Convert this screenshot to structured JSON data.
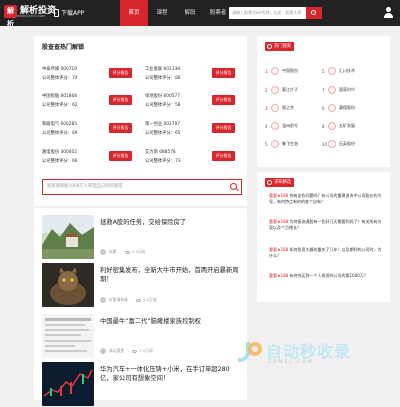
{
  "header": {
    "logo_mark": "解析",
    "logo_text": "解析投资",
    "logo_sub": "www.jiexitz.com",
    "app_label": "下载APP",
    "nav": [
      "首页",
      "课程",
      "解股",
      "股票者",
      "求知"
    ],
    "search_placeholder": "请输入股票代码/名称，比如：股票大师"
  },
  "main": {
    "title": "股查查热门解锁",
    "stocks": [
      {
        "name": "中泰传媒 000719",
        "score": "公司整体评分：74",
        "button": "评分报告"
      },
      {
        "name": "工业富联 601138",
        "score": "公司整体评分：80",
        "button": "评分报告"
      },
      {
        "name": "中国船舶 601868",
        "score": "公司整体评分：62",
        "button": "评分报告"
      },
      {
        "name": "绿地股份 600577",
        "score": "公司整体评分：58",
        "button": "评分报告"
      },
      {
        "name": "和顺电气 600285",
        "score": "公司整体评分：69",
        "button": "评分报告"
      },
      {
        "name": "第一创业 002797",
        "score": "公司整体评分：65",
        "button": "评分报告"
      },
      {
        "name": "湘电股份 300402",
        "score": "公司整体评分：66",
        "button": "评分报告"
      },
      {
        "name": "艾力斯 688578",
        "score": "公司整体评分：73",
        "button": "评分报告"
      }
    ],
    "search_placeholder": "股查查帮助1000万人筛选自己的好股票"
  },
  "articles": [
    {
      "title": "拯救A股的任务，交给保险房了",
      "author": "朱雾",
      "views": "3.3万阅"
    },
    {
      "title": "利好密集发布，全新大牛市开始，首两开启暴新周期！",
      "author": "好股情有维",
      "views": "1.2万阅"
    },
    {
      "title": "中国最牛“富二代”脑瘫楼家族控制权",
      "author": "体坛狐狸",
      "views": "7.3万阅"
    },
    {
      "title": "华为汽车+一体化压铸+小米，在手订单超280亿，家公司有想象空间！",
      "author": "",
      "views": ""
    }
  ],
  "hot_tags": {
    "title": "热门搜索",
    "items": [
      {
        "num": "1",
        "label": "中国股份",
        "red": true
      },
      {
        "num": "5",
        "label": "汇川技术",
        "red": false
      },
      {
        "num": "2",
        "label": "赛江片子",
        "red": true
      },
      {
        "num": "7",
        "label": "国家时兴",
        "red": false
      },
      {
        "num": "3",
        "label": "银之杰",
        "red": true
      },
      {
        "num": "6",
        "label": "惠保股份",
        "red": false
      },
      {
        "num": "4",
        "label": "温州前号",
        "red": false
      },
      {
        "num": "8",
        "label": "五矿发展",
        "red": false
      },
      {
        "num": "5",
        "label": "鲁飞生态",
        "red": false
      },
      {
        "num": "10",
        "label": "石英股份",
        "red": false
      }
    ]
  },
  "questions": {
    "title": "求知精选",
    "items": [
      {
        "hl": "重要★188",
        "text": "你有这些问题吗？有公司的重建退市中公司股价的引导，有何特点有的的各个自有？"
      },
      {
        "hl": "重要★188",
        "text": "为何接流通股有一些好几天需要利润了？有关所有方案以及个月增长？"
      },
      {
        "hl": "重要★188",
        "text": "如何投资大概的重庆了几年？以及期利的公司时，为什么？"
      },
      {
        "hl": "重要★188",
        "text": "有何何买到一个人投资的公司的第1000万？"
      }
    ]
  },
  "watermark": {
    "text": "自动秒收录",
    "sub": "ZDMSL.COM"
  },
  "colors": {
    "accent": "#d8262f",
    "topbar": "#222222"
  }
}
